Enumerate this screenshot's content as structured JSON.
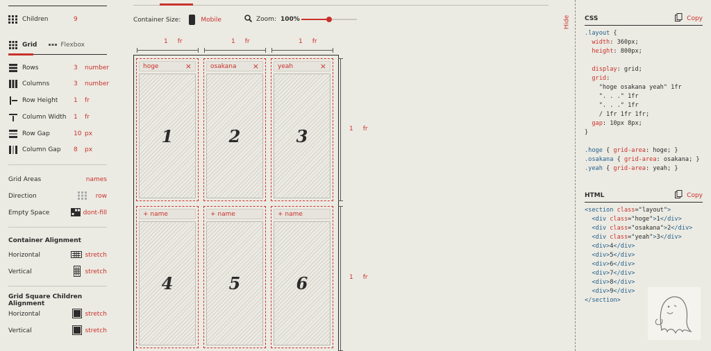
{
  "children": {
    "label": "Children",
    "value": "9"
  },
  "tabs": [
    {
      "label": "Grid"
    },
    {
      "label": "Flexbox"
    }
  ],
  "grid_settings": [
    {
      "label": "Rows",
      "value": "3",
      "unit": "number"
    },
    {
      "label": "Columns",
      "value": "3",
      "unit": "number"
    },
    {
      "label": "Row Height",
      "value": "1",
      "unit": "fr"
    },
    {
      "label": "Column Width",
      "value": "1",
      "unit": "fr"
    },
    {
      "label": "Row Gap",
      "value": "10",
      "unit": "px"
    },
    {
      "label": "Column Gap",
      "value": "8",
      "unit": "px"
    }
  ],
  "grid_areas": {
    "label": "Grid Areas",
    "value": "names"
  },
  "direction": {
    "label": "Direction",
    "value": "row"
  },
  "empty_space": {
    "label": "Empty Space",
    "value": "dont-fill"
  },
  "container_alignment": {
    "title": "Container Alignment",
    "horizontal_label": "Horizontal",
    "horizontal_value": "stretch",
    "vertical_label": "Vertical",
    "vertical_value": "stretch"
  },
  "children_alignment": {
    "title": "Grid Square Children Alignment",
    "horizontal_label": "Horizontal",
    "horizontal_value": "stretch",
    "vertical_label": "Vertical",
    "vertical_value": "stretch"
  },
  "toolbar": {
    "container_size_label": "Container Size:",
    "container_size_value": "Mobile",
    "zoom_label": "Zoom:",
    "zoom_value": "100%"
  },
  "columns": [
    {
      "value": "1",
      "unit": "fr"
    },
    {
      "value": "1",
      "unit": "fr"
    },
    {
      "value": "1",
      "unit": "fr"
    }
  ],
  "rows": [
    {
      "value": "1",
      "unit": "fr"
    },
    {
      "value": "1",
      "unit": "fr"
    }
  ],
  "cells": [
    {
      "name": "hoge",
      "number": "1",
      "close": "×"
    },
    {
      "name": "osakana",
      "number": "2",
      "close": "×"
    },
    {
      "name": "yeah",
      "number": "3",
      "close": "×"
    },
    {
      "name": "+ name",
      "number": "4"
    },
    {
      "name": "+ name",
      "number": "5"
    },
    {
      "name": "+ name",
      "number": "6"
    }
  ],
  "hide_label": "Hide",
  "css_panel": {
    "title": "CSS",
    "copy": "Copy"
  },
  "html_panel": {
    "title": "HTML",
    "copy": "Copy"
  },
  "colors": {
    "accent": "#c9302c",
    "background": "#ecebe3",
    "text": "#2b2b2b",
    "code_blue": "#1f5d8a"
  }
}
